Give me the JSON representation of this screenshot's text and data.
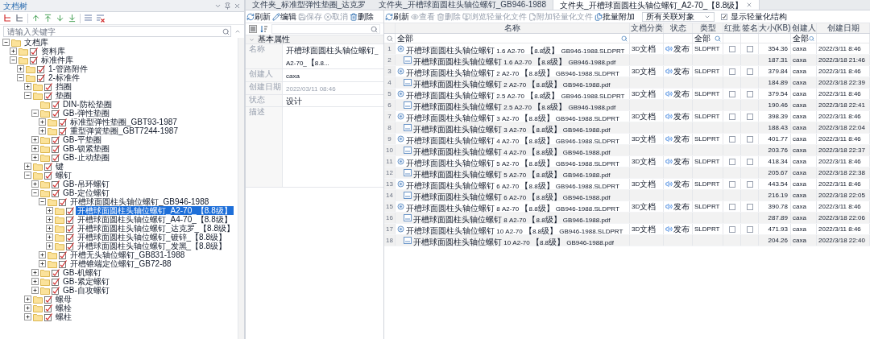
{
  "doc_tree": {
    "title": "文档树",
    "search": {
      "placeholder": "请输入关键字"
    },
    "nodes": [
      {
        "label": "文档库",
        "kind": "root",
        "expanded": true,
        "selected": false,
        "children": [
          {
            "label": "资料库",
            "kind": "node",
            "expanded": false,
            "selected": false
          },
          {
            "label": "标准件库",
            "kind": "node",
            "expanded": true,
            "selected": false,
            "children": [
              {
                "label": "1-管路附件",
                "kind": "node",
                "expanded": false,
                "selected": false
              },
              {
                "label": "2-标准件",
                "kind": "node",
                "expanded": true,
                "selected": false,
                "children": [
                  {
                    "label": "挡圈",
                    "kind": "node",
                    "expanded": false,
                    "selected": false
                  },
                  {
                    "label": "垫圈",
                    "kind": "node",
                    "expanded": true,
                    "selected": false,
                    "children": [
                      {
                        "label": "DIN-防松垫圈",
                        "kind": "leaf",
                        "selected": false
                      },
                      {
                        "label": "GB-弹性垫圈",
                        "kind": "node",
                        "expanded": true,
                        "selected": false,
                        "children": [
                          {
                            "label": "标准型弹性垫圈_GBT93-1987",
                            "kind": "node",
                            "expanded": false,
                            "selected": false
                          },
                          {
                            "label": "重型弹簧垫圈_GBT7244-1987",
                            "kind": "node",
                            "expanded": false,
                            "selected": false
                          }
                        ]
                      },
                      {
                        "label": "GB-平垫圈",
                        "kind": "node",
                        "expanded": false,
                        "selected": false
                      },
                      {
                        "label": "GB-锁紧垫圈",
                        "kind": "node",
                        "expanded": false,
                        "selected": false
                      },
                      {
                        "label": "GB-止动垫圈",
                        "kind": "node",
                        "expanded": false,
                        "selected": false
                      }
                    ]
                  },
                  {
                    "label": "键",
                    "kind": "node",
                    "expanded": false,
                    "selected": false
                  },
                  {
                    "label": "螺钉",
                    "kind": "node",
                    "expanded": true,
                    "selected": false,
                    "children": [
                      {
                        "label": "GB-吊环螺钉",
                        "kind": "node",
                        "expanded": false,
                        "selected": false
                      },
                      {
                        "label": "GB-定位螺钉",
                        "kind": "node",
                        "expanded": true,
                        "selected": false,
                        "children": [
                          {
                            "label": "开槽球面圆柱头轴位螺钉_GB946-1988",
                            "kind": "node",
                            "expanded": true,
                            "selected": false,
                            "children": [
                              {
                                "label": "开槽球面圆柱头轴位螺钉_A2-70_【8.8级】",
                                "kind": "node",
                                "expanded": false,
                                "selected": true
                              },
                              {
                                "label": "开槽球面圆柱头轴位螺钉_A4-70_【8.8级】",
                                "kind": "node",
                                "expanded": false,
                                "selected": false
                              },
                              {
                                "label": "开槽球面圆柱头轴位螺钉_达克罗_【8.8级】",
                                "kind": "node",
                                "expanded": false,
                                "selected": false
                              },
                              {
                                "label": "开槽球面圆柱头轴位螺钉_镀锌_【8.8级】",
                                "kind": "node",
                                "expanded": false,
                                "selected": false
                              },
                              {
                                "label": "开槽球面圆柱头轴位螺钉_发黑_【8.8级】",
                                "kind": "node",
                                "expanded": false,
                                "selected": false
                              }
                            ]
                          },
                          {
                            "label": "开槽无头轴位螺钉_GB831-1988",
                            "kind": "node",
                            "expanded": false,
                            "selected": false
                          },
                          {
                            "label": "开槽锥端定位螺钉_GB72-88",
                            "kind": "node",
                            "expanded": false,
                            "selected": false
                          }
                        ]
                      },
                      {
                        "label": "GB-机螺钉",
                        "kind": "node",
                        "expanded": false,
                        "selected": false
                      },
                      {
                        "label": "GB-紧定螺钉",
                        "kind": "node",
                        "expanded": false,
                        "selected": false
                      },
                      {
                        "label": "GB-自攻螺钉",
                        "kind": "node",
                        "expanded": false,
                        "selected": false
                      }
                    ]
                  },
                  {
                    "label": "螺母",
                    "kind": "node",
                    "expanded": false,
                    "selected": false
                  },
                  {
                    "label": "螺栓",
                    "kind": "node",
                    "expanded": false,
                    "selected": false
                  },
                  {
                    "label": "螺柱",
                    "kind": "node",
                    "expanded": false,
                    "selected": false
                  }
                ]
              }
            ]
          }
        ]
      }
    ]
  },
  "tabs": [
    {
      "label": "文件夹_标准型弹性垫圈_达克罗",
      "selected": false
    },
    {
      "label": "文件夹_开槽球面圆柱头轴位螺钉_GB946-1988",
      "selected": false
    },
    {
      "label": "文件夹_开槽球面圆柱头轴位螺钉_A2-70_【8.8级】",
      "selected": true
    }
  ],
  "properties": {
    "toolbar": [
      {
        "label": "刷新",
        "kind": "refresh",
        "disabled": false
      },
      {
        "label": "编辑",
        "kind": "edit",
        "disabled": false
      },
      {
        "label": "保存",
        "kind": "save",
        "disabled": true
      },
      {
        "label": "取消",
        "kind": "cancel",
        "disabled": true
      },
      {
        "label": "删除",
        "kind": "delete",
        "disabled": false
      }
    ],
    "group": "基本属性",
    "rows": [
      {
        "label": "名称",
        "value": "开槽球面圆柱头轴位螺钉_A2-70_【8.8...",
        "disabled": false
      },
      {
        "label": "创建人",
        "value": "caxa",
        "disabled": false
      },
      {
        "label": "创建日期",
        "value": "2022/03/11 08:46",
        "disabled": true
      },
      {
        "label": "状态",
        "value": "设计",
        "disabled": false
      },
      {
        "label": "描述",
        "disabled": false
      }
    ]
  },
  "files": {
    "toolbar": [
      {
        "label": "刷新",
        "kind": "refresh",
        "disabled": false
      },
      {
        "label": "查看",
        "kind": "view",
        "disabled": true
      },
      {
        "label": "删除",
        "kind": "delete",
        "disabled": true
      },
      {
        "label": "浏览轻量化文件",
        "kind": "browse",
        "disabled": true
      },
      {
        "label": "附加轻量化文件",
        "kind": "attach",
        "disabled": true
      },
      {
        "label": "批量附加",
        "kind": "batch",
        "disabled": false
      }
    ],
    "relation_filter": "所有关联对象",
    "show_lightweight": {
      "label": "显示轻量化结构",
      "checked": true
    },
    "columns": [
      {
        "label": "名称",
        "filter": "全部"
      },
      {
        "label": "文档分类"
      },
      {
        "label": "状态"
      },
      {
        "label": "类型",
        "filter": "全部"
      },
      {
        "label": "红批"
      },
      {
        "label": "签名"
      },
      {
        "label": "大小(KB)"
      },
      {
        "label": "创建人",
        "filter": "全部"
      },
      {
        "label": "创建日期"
      }
    ],
    "rows": [
      {
        "no": "1",
        "kind": "part",
        "name": "开槽球面圆柱头轴位螺钉 1.6 A2-70 【8.8级】 GB946-1988.SLDPRT",
        "category": "3D文档",
        "status": "发布",
        "type": "SLDPRT",
        "red_mark": false,
        "signed": false,
        "size": "354.36",
        "creator": "caxa",
        "created": "2022/3/11 8:46"
      },
      {
        "no": "2",
        "kind": "file",
        "name": "开槽球面圆柱头轴位螺钉 1.6 A2-70 【8.8级】 GB946-1988.pdf",
        "size": "187.31",
        "creator": "caxa",
        "created": "2022/3/18 21:46"
      },
      {
        "no": "3",
        "kind": "part",
        "name": "开槽球面圆柱头轴位螺钉 2 A2-70 【8.8级】 GB946-1988.SLDPRT",
        "category": "3D文档",
        "status": "发布",
        "type": "SLDPRT",
        "red_mark": false,
        "signed": false,
        "size": "379.84",
        "creator": "caxa",
        "created": "2022/3/11 8:46"
      },
      {
        "no": "4",
        "kind": "file",
        "name": "开槽球面圆柱头轴位螺钉 2 A2-70 【8.8级】 GB946-1988.pdf",
        "size": "184.89",
        "creator": "caxa",
        "created": "2022/3/18 22:39"
      },
      {
        "no": "5",
        "kind": "part",
        "name": "开槽球面圆柱头轴位螺钉 2.5 A2-70 【8.8级】 GB946-1988.SLDPRT",
        "category": "3D文档",
        "status": "发布",
        "type": "SLDPRT",
        "red_mark": false,
        "signed": false,
        "size": "379.54",
        "creator": "caxa",
        "created": "2022/3/11 8:46"
      },
      {
        "no": "6",
        "kind": "file",
        "name": "开槽球面圆柱头轴位螺钉 2.5 A2-70 【8.8级】 GB946-1988.pdf",
        "size": "190.46",
        "creator": "caxa",
        "created": "2022/3/18 22:41"
      },
      {
        "no": "7",
        "kind": "part",
        "name": "开槽球面圆柱头轴位螺钉 3 A2-70 【8.8级】 GB946-1988.SLDPRT",
        "category": "3D文档",
        "status": "发布",
        "type": "SLDPRT",
        "red_mark": false,
        "signed": false,
        "size": "398.39",
        "creator": "caxa",
        "created": "2022/3/11 8:46"
      },
      {
        "no": "8",
        "kind": "file",
        "name": "开槽球面圆柱头轴位螺钉 3 A2-70 【8.8级】 GB946-1988.pdf",
        "size": "188.43",
        "creator": "caxa",
        "created": "2022/3/18 22:04"
      },
      {
        "no": "9",
        "kind": "part",
        "name": "开槽球面圆柱头轴位螺钉 4 A2-70 【8.8级】 GB946-1988.SLDPRT",
        "category": "3D文档",
        "status": "发布",
        "type": "SLDPRT",
        "red_mark": false,
        "signed": false,
        "size": "401.77",
        "creator": "caxa",
        "created": "2022/3/11 8:46"
      },
      {
        "no": "10",
        "kind": "file",
        "name": "开槽球面圆柱头轴位螺钉 4 A2-70 【8.8级】 GB946-1988.pdf",
        "size": "203.76",
        "creator": "caxa",
        "created": "2022/3/18 22:37"
      },
      {
        "no": "11",
        "kind": "part",
        "name": "开槽球面圆柱头轴位螺钉 5 A2-70 【8.8级】 GB946-1988.SLDPRT",
        "category": "3D文档",
        "status": "发布",
        "type": "SLDPRT",
        "red_mark": false,
        "signed": false,
        "size": "418.34",
        "creator": "caxa",
        "created": "2022/3/11 8:46"
      },
      {
        "no": "12",
        "kind": "file",
        "name": "开槽球面圆柱头轴位螺钉 5 A2-70 【8.8级】 GB946-1988.pdf",
        "size": "205.67",
        "creator": "caxa",
        "created": "2022/3/18 22:38"
      },
      {
        "no": "13",
        "kind": "part",
        "name": "开槽球面圆柱头轴位螺钉 6 A2-70 【8.8级】 GB946-1988.SLDPRT",
        "category": "3D文档",
        "status": "发布",
        "type": "SLDPRT",
        "red_mark": false,
        "signed": false,
        "size": "443.54",
        "creator": "caxa",
        "created": "2022/3/11 8:46"
      },
      {
        "no": "14",
        "kind": "file",
        "name": "开槽球面圆柱头轴位螺钉 6 A2-70 【8.8级】 GB946-1988.pdf",
        "size": "216.19",
        "creator": "caxa",
        "created": "2022/3/18 22:05"
      },
      {
        "no": "15",
        "kind": "part",
        "name": "开槽球面圆柱头轴位螺钉 8 A2-70 【8.8级】 GB946-1988.SLDPRT",
        "category": "3D文档",
        "status": "发布",
        "type": "SLDPRT",
        "red_mark": false,
        "signed": false,
        "size": "390.78",
        "creator": "caxa",
        "created": "2022/3/11 8:46"
      },
      {
        "no": "16",
        "kind": "file",
        "name": "开槽球面圆柱头轴位螺钉 8 A2-70 【8.8级】 GB946-1988.pdf",
        "size": "287.89",
        "creator": "caxa",
        "created": "2022/3/18 22:06"
      },
      {
        "no": "17",
        "kind": "part",
        "name": "开槽球面圆柱头轴位螺钉 10 A2-70 【8.8级】 GB946-1988.SLDPRT",
        "category": "3D文档",
        "status": "发布",
        "type": "SLDPRT",
        "red_mark": false,
        "signed": false,
        "size": "471.93",
        "creator": "caxa",
        "created": "2022/3/11 8:46"
      },
      {
        "no": "18",
        "kind": "file",
        "name": "开槽球面圆柱头轴位螺钉 10 A2-70 【8.8级】 GB946-1988.pdf",
        "size": "204.26",
        "creator": "caxa",
        "created": "2022/3/18 22:40"
      }
    ]
  }
}
